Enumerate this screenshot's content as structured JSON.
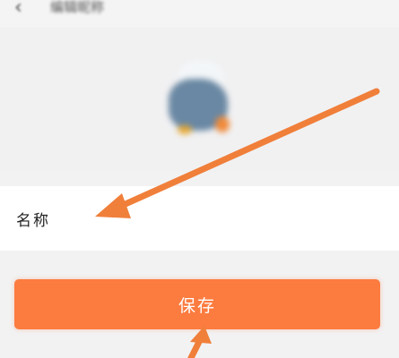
{
  "header": {
    "title": "编辑昵称",
    "back_icon": "back-arrow-icon"
  },
  "avatar": {
    "icon": "avatar-image"
  },
  "form": {
    "name_label": "名称"
  },
  "actions": {
    "save_label": "保存"
  },
  "colors": {
    "accent": "#fc7b3f",
    "annotation_arrow": "#f07f3a"
  }
}
